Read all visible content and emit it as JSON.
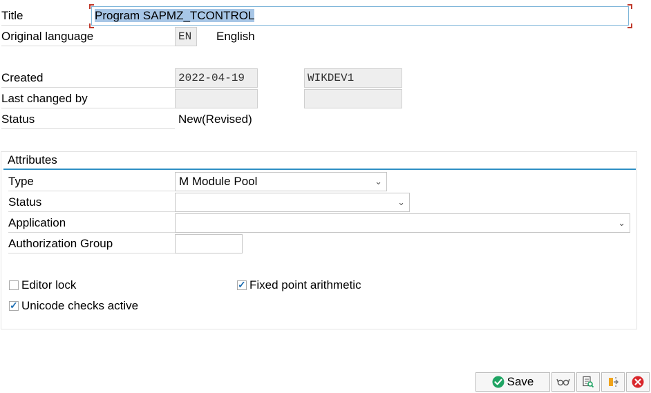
{
  "header": {
    "title_label": "Title",
    "title_value": "Program SAPMZ_TCONTROL",
    "orig_lang_label": "Original language",
    "orig_lang_code": "EN",
    "orig_lang_name": "English",
    "created_label": "Created",
    "created_date": "2022-04-19",
    "created_by": "WIKDEV1",
    "last_changed_label": "Last changed by",
    "last_changed_date": "",
    "last_changed_user": "",
    "status_label": "Status",
    "status_value": "New(Revised)"
  },
  "attributes": {
    "group_title": "Attributes",
    "type_label": "Type",
    "type_value": "M Module Pool",
    "status_label": "Status",
    "status_value": "",
    "application_label": "Application",
    "application_value": "",
    "auth_group_label": "Authorization Group",
    "auth_group_value": "",
    "editor_lock_label": "Editor lock",
    "editor_lock_checked": false,
    "fixed_point_label": "Fixed point arithmetic",
    "fixed_point_checked": true,
    "unicode_label": "Unicode checks active",
    "unicode_checked": true
  },
  "toolbar": {
    "save_label": "Save",
    "buttons": [
      "save-icon",
      "glasses-icon",
      "document-search-icon",
      "transport-icon",
      "cancel-icon"
    ]
  },
  "colors": {
    "accent": "#2f8fc4",
    "selection": "#a7c6e6",
    "readonly_bg": "#eeeeee",
    "ok_green": "#1fa463",
    "cancel_red": "#d9262b"
  }
}
